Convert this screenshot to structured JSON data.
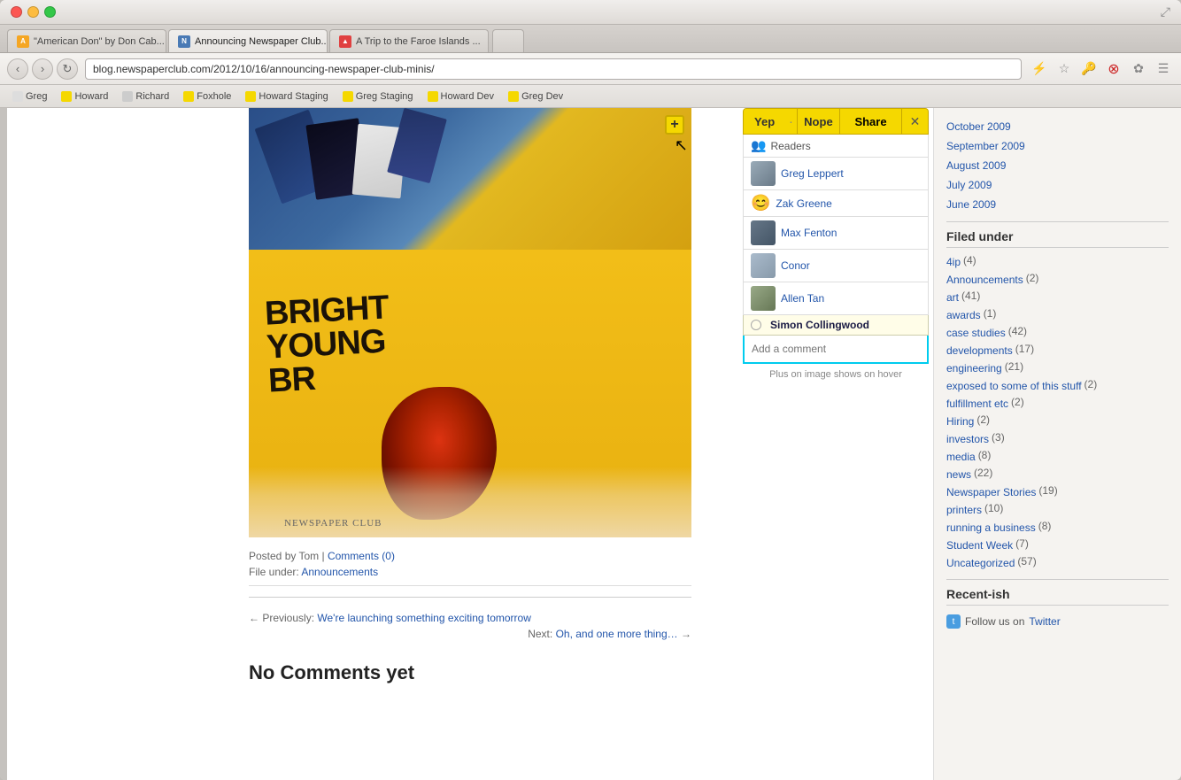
{
  "browser": {
    "tabs": [
      {
        "id": "tab1",
        "label": "\"American Don\" by Don Cab...",
        "favicon_type": "orange",
        "active": false
      },
      {
        "id": "tab2",
        "label": "Announcing Newspaper Club...",
        "favicon_type": "news",
        "active": true
      },
      {
        "id": "tab3",
        "label": "A Trip to the Faroe Islands ...",
        "favicon_type": "trip",
        "active": false
      }
    ],
    "address": "blog.newspaperclub.com/2012/10/16/announcing-newspaper-club-minis/",
    "bookmarks": [
      {
        "label": "Greg"
      },
      {
        "label": "Howard"
      },
      {
        "label": "Richard"
      },
      {
        "label": "Foxhole"
      },
      {
        "label": "Howard Staging"
      },
      {
        "label": "Greg Staging"
      },
      {
        "label": "Howard Dev"
      },
      {
        "label": "Greg Dev"
      }
    ]
  },
  "article": {
    "posted_by_text": "Posted by Tom |",
    "comments_link": "Comments (0)",
    "file_under_text": "File under:",
    "announcements_link": "Announcements",
    "prev_label": "← Previously:",
    "prev_link_text": "We're launching something exciting tomorrow",
    "next_label": "Next:",
    "next_link_text": "Oh, and one more thing…",
    "next_arrow": "→",
    "no_comments": "No Comments yet"
  },
  "sidebar": {
    "dates": [
      {
        "label": "October 2009",
        "url": "#"
      },
      {
        "label": "September 2009",
        "url": "#"
      },
      {
        "label": "August 2009",
        "url": "#"
      },
      {
        "label": "July 2009",
        "url": "#"
      },
      {
        "label": "June 2009",
        "url": "#"
      }
    ],
    "filed_under_title": "Filed under",
    "categories": [
      {
        "label": "4ip",
        "count": "(4)"
      },
      {
        "label": "Announcements",
        "count": "(2)"
      },
      {
        "label": "art",
        "count": "(41)"
      },
      {
        "label": "awards",
        "count": "(1)"
      },
      {
        "label": "case studies",
        "count": "(42)"
      },
      {
        "label": "developments",
        "count": "(17)"
      },
      {
        "label": "engineering",
        "count": "(21)"
      },
      {
        "label": "exposed to some of this stuff",
        "count": "(2)"
      },
      {
        "label": "fulfillment etc",
        "count": "(2)"
      },
      {
        "label": "Hiring",
        "count": "(2)"
      },
      {
        "label": "investors",
        "count": "(3)"
      },
      {
        "label": "media",
        "count": "(8)"
      },
      {
        "label": "news",
        "count": "(22)"
      },
      {
        "label": "Newspaper Stories",
        "count": "(19)"
      },
      {
        "label": "printers",
        "count": "(10)"
      },
      {
        "label": "running a business",
        "count": "(8)"
      },
      {
        "label": "Student Week",
        "count": "(7)"
      },
      {
        "label": "Uncategorized",
        "count": "(57)"
      }
    ],
    "recent_title": "Recent-ish",
    "follow_text": "Follow us on",
    "twitter_link": "Twitter"
  },
  "overlay": {
    "yep_label": "Yep",
    "dot_separator": "·",
    "nope_label": "Nope",
    "share_label": "Share",
    "readers_label": "Readers",
    "users": [
      {
        "name": "Greg Leppert",
        "avatar_color": "#8899aa"
      },
      {
        "name": "Zak Greene",
        "avatar_color": "#aabbcc"
      },
      {
        "name": "Max Fenton",
        "avatar_color": "#778899"
      },
      {
        "name": "Conor",
        "avatar_color": "#99aaaa"
      },
      {
        "name": "Allen Tan",
        "avatar_color": "#aabbaa"
      },
      {
        "name": "Simon Collingwood",
        "avatar_color": "#bbaaaa"
      }
    ],
    "comment_placeholder": "Add a comment",
    "annotation": "Plus on image shows on hover"
  }
}
